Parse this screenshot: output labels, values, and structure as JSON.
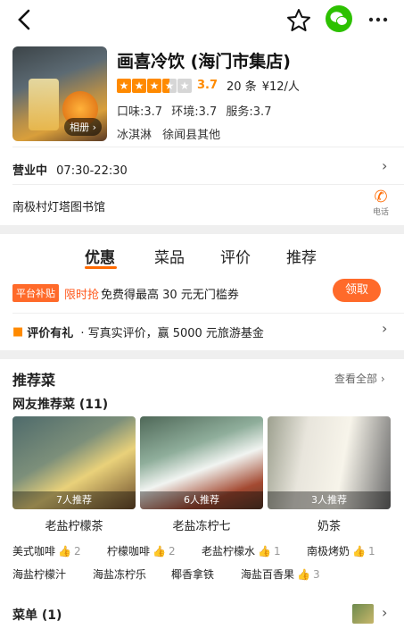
{
  "header": {
    "back_icon": "chevron-left-icon",
    "favorite_icon": "star-outline-icon",
    "wechat_icon": "wechat-icon",
    "more_icon": "more-dots-icon"
  },
  "shop": {
    "name": "画喜冷饮 (海门市集店)",
    "album_label": "相册",
    "rating": 3.7,
    "rating_text": "3.7",
    "reviews_text": "20 条",
    "price_text": "¥12/人",
    "taste": "口味:3.7",
    "environment": "环境:3.7",
    "service": "服务:3.7",
    "category": "冰淇淋",
    "district": "徐闻县其他",
    "status": "营业中",
    "hours": "07:30-22:30",
    "address": "南极村灯塔图书馆",
    "phone_label": "电话",
    "accent_color": "#ff6a00"
  },
  "tabs": [
    {
      "label": "优惠",
      "active": true
    },
    {
      "label": "菜品",
      "active": false
    },
    {
      "label": "评价",
      "active": false
    },
    {
      "label": "推荐",
      "active": false
    }
  ],
  "promo": {
    "badge": "平台补贴",
    "limited": "限时抢",
    "text": "免费得最高 30 元无门槛券",
    "button": "领取"
  },
  "review_gift": {
    "title": "评价有礼",
    "text": "· 写真实评价，赢 5000 元旅游基金"
  },
  "recommend": {
    "title": "推荐菜",
    "see_all": "查看全部",
    "subtitle": "网友推荐菜 (11)",
    "dishes": [
      {
        "name": "老盐柠檬茶",
        "count": "7人推荐"
      },
      {
        "name": "老盐冻柠七",
        "count": "6人推荐"
      },
      {
        "name": "奶茶",
        "count": "3人推荐"
      }
    ],
    "tags": [
      {
        "name": "美式咖啡",
        "count": "2"
      },
      {
        "name": "柠檬咖啡",
        "count": "2"
      },
      {
        "name": "老盐柠檬水",
        "count": "1"
      },
      {
        "name": "南极烤奶",
        "count": "1"
      },
      {
        "name": "海盐柠檬汁",
        "count": ""
      },
      {
        "name": "海盐冻柠乐",
        "count": ""
      },
      {
        "name": "椰香拿铁",
        "count": ""
      },
      {
        "name": "海盐百香果",
        "count": "3"
      }
    ]
  },
  "menu": {
    "title": "菜单 (1)"
  }
}
